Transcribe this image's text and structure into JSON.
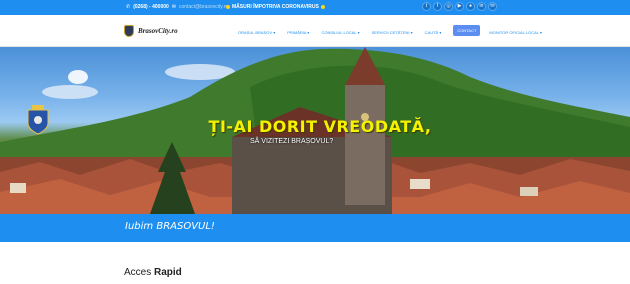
{
  "topbar": {
    "phone": "(0268) - 400000",
    "email": "contact@brasovcity.ro",
    "covid": "MĂSURI ÎMPOTRIVA CORONAVIRUS",
    "social_icons": [
      "twitter-icon",
      "facebook-icon",
      "instagram-icon",
      "youtube-icon",
      "flickr-icon",
      "linkedin-icon",
      "mail-icon"
    ]
  },
  "nav": {
    "logo_text": "BrasovCity.ro",
    "items": [
      {
        "label": "ORAȘUL BRAȘOV ▾"
      },
      {
        "label": "PRIMĂRIA ▾"
      },
      {
        "label": "CONSILIUL LOCAL ▾"
      },
      {
        "label": "SERVICII CETĂȚENI ▾"
      },
      {
        "label": "CAUTĂ ▾"
      },
      {
        "label": "CONTACT"
      },
      {
        "label": "MONITOR OFICIAL LOCAL ▾"
      }
    ]
  },
  "hero": {
    "title": "ȚI-AI DORIT VREODATĂ,",
    "subtitle": "SĂ VIZITEZI BRAȘOVUL?"
  },
  "band": {
    "text": "Iubim BRASOVUL!"
  },
  "quick_access": {
    "prefix": "Acces",
    "bold": "Rapid"
  },
  "colors": {
    "accent": "#1e8ff0",
    "hero_title": "#f5f200"
  }
}
